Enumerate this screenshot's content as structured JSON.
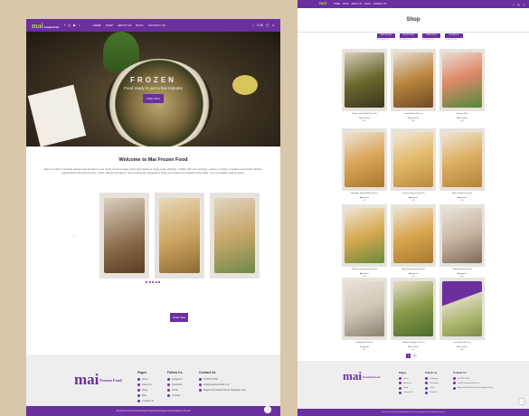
{
  "colors": {
    "brand": "#6b2fa0",
    "accent_green": "#b6d13a",
    "background": "#d8c7a8"
  },
  "left": {
    "nav": {
      "logo": "mai",
      "logo_sub": "Frozen Food",
      "social_icons": [
        "facebook-icon",
        "instagram-icon",
        "youtube-icon",
        "tiktok-icon"
      ],
      "menu": [
        "HOME",
        "SHOP",
        "ABOUT US",
        "BLOG",
        "CONTACT US"
      ],
      "cart_label": "0.00",
      "right_icons": [
        "search-icon",
        "cart-icon",
        "user-icon"
      ]
    },
    "hero": {
      "title": "FROZEN",
      "subtitle": "Food ready in just a few minutes",
      "button": "Order Now"
    },
    "welcome": {
      "title": "Welcome to Mai Frozen Food",
      "text": "Born in mother's heartfelt passion and devotion to her family comes a range of the best delicious ready-made offerings. Crafted with care and love, explore a variety of pastries and tasteful dishes. Handcrafted with only premium, fresh, natural ingredients. Our products are designed to bring your loved ones together at the table, one memorable meal at a time."
    },
    "carousel": {
      "prev": "‹",
      "next": "›",
      "dots": 5
    },
    "order_button": "Order Now",
    "footer": {
      "logo": "mai",
      "logo_sub": "Frozen Food",
      "pages_title": "Pages",
      "pages": [
        "Home",
        "About Us",
        "Shop",
        "Blog",
        "Contact Us"
      ],
      "follow_title": "Follow Us",
      "follow": [
        "Instagram",
        "Facebook",
        "Tiktok",
        "Youtube"
      ],
      "contact_title": "Contact Us",
      "contact": [
        "07700170765",
        "info@maifrozenfood.com",
        "Mageeb Al Zahawi Street, Baghdad, Iraq"
      ],
      "copyright": "Mai Frozen Food 2024 All Rights Reserved Designed & Developed by Proedit"
    }
  },
  "right": {
    "nav": {
      "logo": "mai",
      "menu": [
        "HOME",
        "SHOP",
        "ABOUT US",
        "BLOG",
        "CONTACT US"
      ]
    },
    "title": "Shop",
    "filters": [
      {
        "label": "MAIN DISHES",
        "count": "8 PRODUCTS"
      },
      {
        "label": "APPETIZERS",
        "count": "8 PRODUCTS"
      },
      {
        "label": "DUMPLINGS",
        "count": "4 PRODUCTS"
      },
      {
        "label": "DESSERTS",
        "count": "3 PRODUCTS"
      }
    ],
    "products": [
      {
        "name": "Dolma with Stuffed Zucchini",
        "cat": "Main Dishes",
        "price": "IQD"
      },
      {
        "name": "Lamb Kebab (Pieces)",
        "cat": "Main Dishes",
        "price": "IQD"
      },
      {
        "name": "Salmon Fillet",
        "cat": "Main Dishes",
        "price": "IQD"
      },
      {
        "name": "Vegetable Spring Rolls (Pieces)",
        "cat": "Appetizers",
        "price": "IQD"
      },
      {
        "name": "Cheese Samosa (Pieces)",
        "cat": "Appetizers",
        "price": "IQD"
      },
      {
        "name": "Meat Samosa (Pieces)",
        "cat": "Appetizers",
        "price": "IQD"
      },
      {
        "name": "Cheese Sambousek (Pieces)",
        "cat": "Appetizers",
        "price": "IQD"
      },
      {
        "name": "Meat Sambousek (Pieces)",
        "cat": "Appetizers",
        "price": "IQD"
      },
      {
        "name": "Kubba Halab (Pieces)",
        "cat": "Appetizers",
        "price": "IQD"
      },
      {
        "name": "Dumplings (Pieces)",
        "cat": "Dumplings",
        "price": "IQD"
      },
      {
        "name": "Stuffed Cabbage (Pieces)",
        "cat": "Main Dishes",
        "price": "IQD"
      },
      {
        "name": "Lentil Soup (Pieces)",
        "cat": "Main Dishes",
        "price": "IQD"
      }
    ],
    "pager": [
      "1",
      "2"
    ],
    "footer": {
      "logo": "mai",
      "logo_sub": "Frozen Food",
      "pages_title": "Pages",
      "pages": [
        "Home",
        "About Us",
        "Shop",
        "Contact Us"
      ],
      "follow_title": "Follow Us",
      "follow": [
        "Instagram",
        "Facebook",
        "Tiktok",
        "Youtube"
      ],
      "contact_title": "Contact Us",
      "contact": [
        "07700170765",
        "info@maifrozenfood.com",
        "Mageeb Al Zahawi Street, Baghdad, Iraq"
      ],
      "copyright": "Mai Frozen Food 2024 All Rights Reserved Designed & Developed by Proedit"
    }
  }
}
